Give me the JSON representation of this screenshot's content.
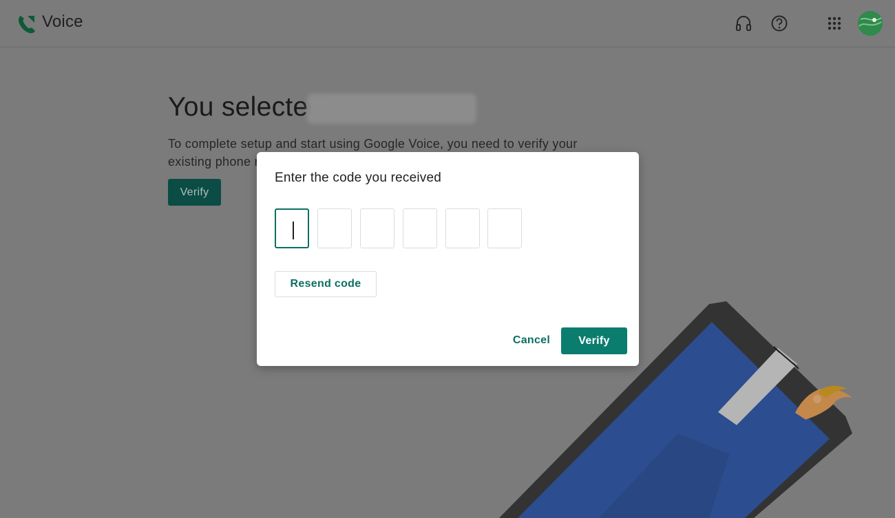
{
  "header": {
    "app_name": "Voice",
    "icons": [
      "voice-logo-icon",
      "headset-icon",
      "help-icon",
      "apps-grid-icon",
      "avatar"
    ]
  },
  "main": {
    "heading": "You selected",
    "description": "To complete setup and start using Google Voice, you need to verify your existing phone number",
    "verify_label": "Verify"
  },
  "dialog": {
    "title": "Enter the code you received",
    "code_values": [
      "",
      "",
      "",
      "",
      "",
      ""
    ],
    "resend_label": "Resend code",
    "cancel_label": "Cancel",
    "verify_label": "Verify"
  },
  "colors": {
    "accent": "#0b7d6f",
    "scrim": "#7b7b7b"
  }
}
